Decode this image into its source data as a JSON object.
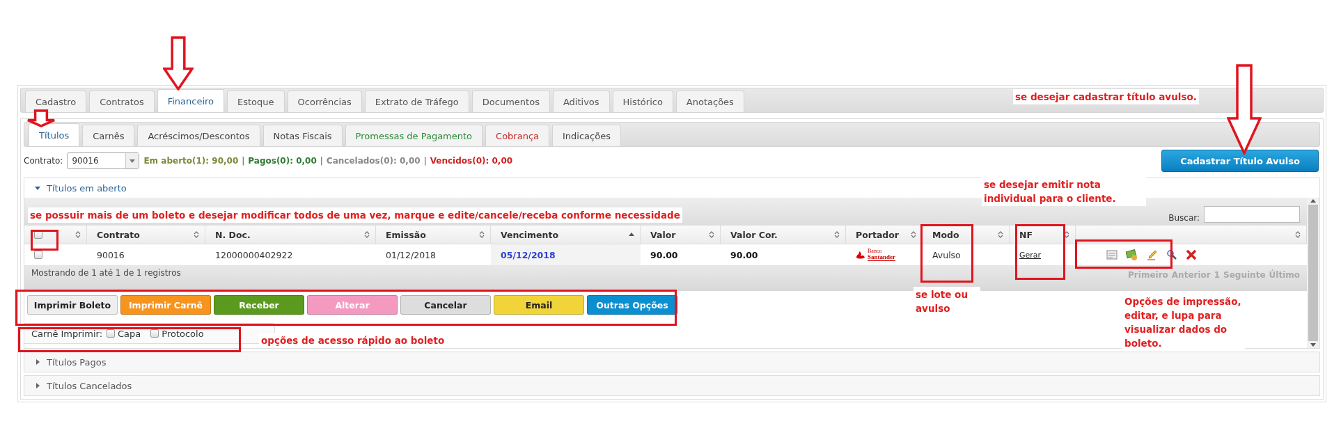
{
  "top_tabs": [
    {
      "label": "Cadastro",
      "selected": false
    },
    {
      "label": "Contratos",
      "selected": false
    },
    {
      "label": "Financeiro",
      "selected": true
    },
    {
      "label": "Estoque",
      "selected": false
    },
    {
      "label": "Ocorrências",
      "selected": false
    },
    {
      "label": "Extrato de Tráfego",
      "selected": false
    },
    {
      "label": "Documentos",
      "selected": false
    },
    {
      "label": "Aditivos",
      "selected": false
    },
    {
      "label": "Histórico",
      "selected": false
    },
    {
      "label": "Anotações",
      "selected": false
    }
  ],
  "sub_tabs": [
    {
      "label": "Títulos",
      "selected": true,
      "color": "#2a6496"
    },
    {
      "label": "Carnês",
      "selected": false,
      "color": "#444444"
    },
    {
      "label": "Acréscimos/Descontos",
      "selected": false,
      "color": "#444444"
    },
    {
      "label": "Notas Fiscais",
      "selected": false,
      "color": "#444444"
    },
    {
      "label": "Promessas de Pagamento",
      "selected": false,
      "color": "#2e8b3a"
    },
    {
      "label": "Cobrança",
      "selected": false,
      "color": "#c62828"
    },
    {
      "label": "Indicações",
      "selected": false,
      "color": "#444444"
    }
  ],
  "contract": {
    "label": "Contrato:",
    "value": "90016"
  },
  "summary": [
    {
      "kind": "value",
      "text": "Em aberto(1): 90,00",
      "color": "#7a8a3a"
    },
    {
      "kind": "separator",
      "text": "|"
    },
    {
      "kind": "value",
      "text": "Pagos(0): 0,00",
      "color": "#2e7d32"
    },
    {
      "kind": "separator",
      "text": "|"
    },
    {
      "kind": "value",
      "text": "Cancelados(0): 0,00",
      "color": "#888888"
    },
    {
      "kind": "separator",
      "text": "|"
    },
    {
      "kind": "value",
      "text": "Vencidos(0): 0,00",
      "color": "#cc2222"
    }
  ],
  "new_title_button": "Cadastrar Título Avulso",
  "sections": [
    {
      "label": "Títulos em aberto",
      "expanded": true
    },
    {
      "label": "Títulos Pagos",
      "expanded": false
    },
    {
      "label": "Títulos Cancelados",
      "expanded": false
    }
  ],
  "search": {
    "label": "Buscar:"
  },
  "table": {
    "columns": [
      {
        "kind": "check",
        "sorted": false,
        "checked": false
      },
      {
        "kind": "text",
        "label": "Contrato",
        "sorted": false
      },
      {
        "kind": "text",
        "label": "N. Doc.",
        "sorted": false
      },
      {
        "kind": "text",
        "label": "Emissão",
        "sorted": false
      },
      {
        "kind": "text",
        "label": "Vencimento",
        "sorted": true
      },
      {
        "kind": "text",
        "label": "Valor",
        "sorted": false
      },
      {
        "kind": "text",
        "label": "Valor Cor.",
        "sorted": false
      },
      {
        "kind": "text",
        "label": "Portador",
        "sorted": false
      },
      {
        "kind": "text",
        "label": "Modo",
        "sorted": false
      },
      {
        "kind": "text",
        "label": "NF",
        "sorted": false
      },
      {
        "kind": "empty",
        "sorted": false
      }
    ],
    "rows": [
      {
        "checked": false,
        "contrato": "90016",
        "n_doc": "12000000402922",
        "emissao": "01/12/2018",
        "vencimento": "05/12/2018",
        "valor": "90.00",
        "valor_cor": "90.00",
        "portador": {
          "small": "Banco",
          "name": "Santander"
        },
        "modo": "Avulso",
        "nf": "Gerar"
      }
    ]
  },
  "footer": {
    "info": "Mostrando de 1 até 1 de 1 registros",
    "pagination": [
      {
        "label": "Primeiro",
        "disabled": true
      },
      {
        "label": "Anterior",
        "disabled": true
      },
      {
        "label": "1",
        "disabled": true
      },
      {
        "label": "Seguinte",
        "disabled": true
      },
      {
        "label": "Último",
        "disabled": true
      }
    ]
  },
  "actions": [
    {
      "label": "Imprimir Boleto",
      "color": "#eeeeee"
    },
    {
      "label": "Imprimir Carnê",
      "color": "#f7941d"
    },
    {
      "label": "Receber",
      "color": "#5b9a1f"
    },
    {
      "label": "Alterar",
      "color": "#f49ac1"
    },
    {
      "label": "Cancelar",
      "color": "#dddddd"
    },
    {
      "label": "Email",
      "color": "#f0d43a"
    },
    {
      "label": "Outras Opções",
      "color": "#0b8fd1"
    }
  ],
  "carne": {
    "label": "Carnê Imprimir:",
    "options": [
      {
        "label": "Capa",
        "checked": false
      },
      {
        "label": "Protocolo",
        "checked": false
      }
    ]
  },
  "annotations": [
    {
      "text": "se desejar cadastrar título avulso."
    },
    {
      "text": "se desejar emitir nota individual para o cliente."
    },
    {
      "text": "se possuir mais de um boleto e desejar modificar todos de uma vez, marque e edite/cancele/receba conforme necessidade"
    },
    {
      "text": "opções de acesso rápido ao boleto"
    },
    {
      "text": "se lote ou avulso"
    },
    {
      "text": "Opções de impressão, editar, e lupa para visualizar dados do boleto."
    }
  ]
}
